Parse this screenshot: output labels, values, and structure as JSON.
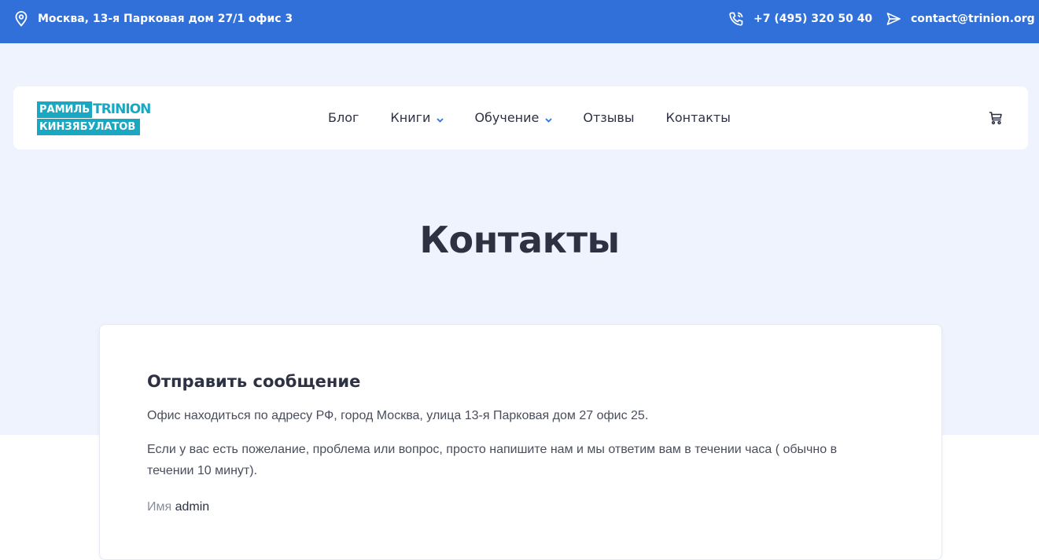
{
  "topbar": {
    "address": "Москва, 13-я Парковая дом 27/1 офис 3",
    "phone": "+7 (495) 320 50 40",
    "email": "contact@trinion.org",
    "icons": {
      "address": "map-pin-icon",
      "phone": "phone-icon",
      "email": "send-icon"
    },
    "bg_color": "#3170d9"
  },
  "logo": {
    "line1_a": "РАМИЛЬ",
    "line1_b": "TRINION",
    "line2": "КИНЗЯБУЛАТОВ",
    "color": "#1aa7c2"
  },
  "nav": {
    "items": [
      {
        "label": "Блог",
        "has_dropdown": false
      },
      {
        "label": "Книги",
        "has_dropdown": true
      },
      {
        "label": "Обучение",
        "has_dropdown": true
      },
      {
        "label": "Отзывы",
        "has_dropdown": false
      },
      {
        "label": "Контакты",
        "has_dropdown": false
      }
    ],
    "cart_icon": "cart-icon"
  },
  "page": {
    "title": "Контакты"
  },
  "contact_card": {
    "heading": "Отправить сообщение",
    "paragraph1": "Офис находиться по адресу РФ, город Москва, улица 13-я Парковая дом 27 офис 25.",
    "paragraph2": "Если у вас есть пожелание, проблема или вопрос, просто напишите нам и мы ответим вам в течении часа ( обычно в течении 10 минут).",
    "name_label": "Имя",
    "name_value": "admin"
  }
}
